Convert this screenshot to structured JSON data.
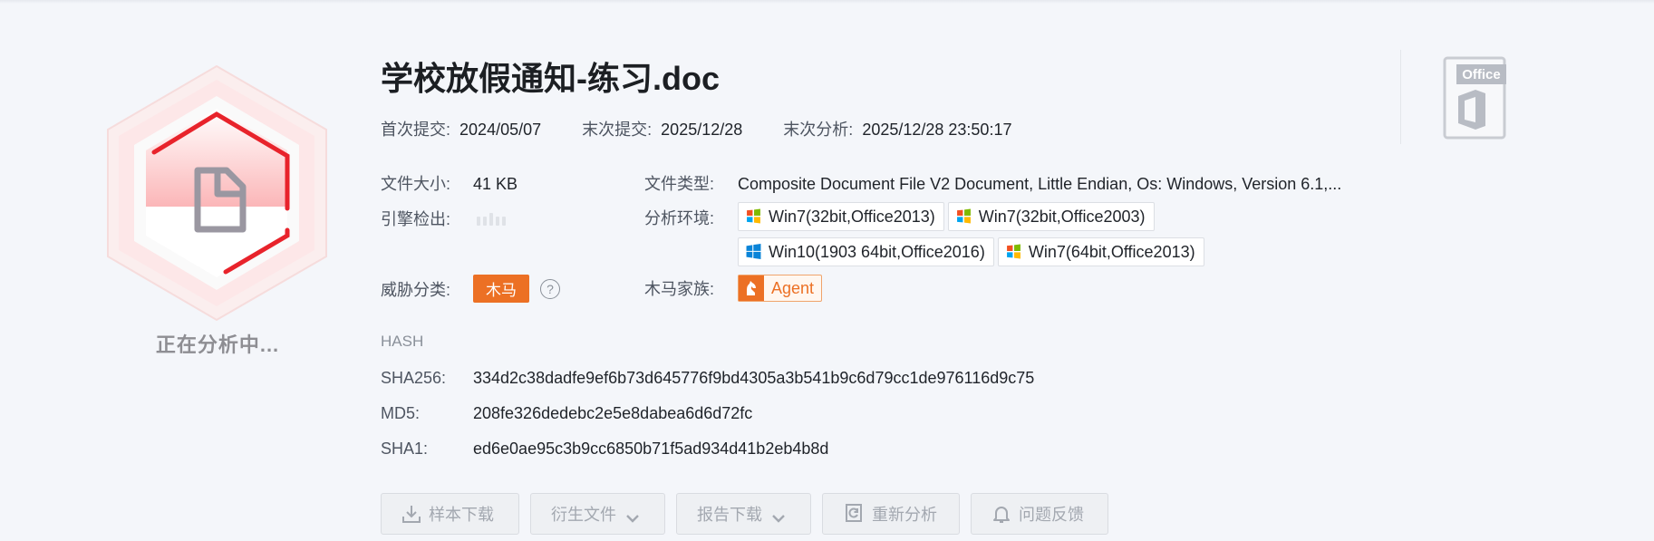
{
  "status": {
    "text": "正在分析中..."
  },
  "file": {
    "title": "学校放假通知-练习.doc",
    "first_submit_label": "首次提交:",
    "first_submit_value": "2024/05/07",
    "last_submit_label": "末次提交:",
    "last_submit_value": "2025/12/28",
    "last_analysis_label": "末次分析:",
    "last_analysis_value": "2025/12/28 23:50:17",
    "size_label": "文件大小:",
    "size_value": "41 KB",
    "type_label": "文件类型:",
    "type_value": "Composite Document File V2 Document, Little Endian, Os: Windows, Version 6.1,...",
    "engine_label": "引擎检出:",
    "env_label": "分析环境:",
    "environments": [
      "Win7(32bit,Office2013)",
      "Win7(32bit,Office2003)",
      "Win10(1903 64bit,Office2016)",
      "Win7(64bit,Office2013)"
    ],
    "threat_label": "威胁分类:",
    "threat_value": "木马",
    "help_symbol": "?",
    "family_label": "木马家族:",
    "family_value": "Agent"
  },
  "hash": {
    "heading": "HASH",
    "sha256_label": "SHA256:",
    "sha256_value": "334d2c38dadfe9ef6b73d645776f9bd4305a3b541b9c6d79cc1de976116d9c75",
    "md5_label": "MD5:",
    "md5_value": "208fe326dedebc2e5e8dabea6d6d72fc",
    "sha1_label": "SHA1:",
    "sha1_value": "ed6e0ae95c3b9cc6850b71f5ad934d41b2eb4b8d"
  },
  "actions": {
    "download_sample": "样本下载",
    "derived_files": "衍生文件",
    "download_report": "报告下载",
    "reanalyze": "重新分析",
    "feedback": "问题反馈"
  },
  "office_badge": {
    "label": "Office"
  },
  "colors": {
    "accent": "#ec7024",
    "danger": "#e8232b",
    "background": "#f4f6fa"
  }
}
